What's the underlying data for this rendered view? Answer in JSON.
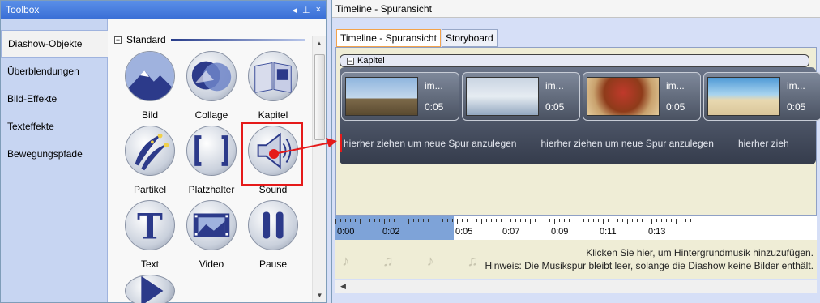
{
  "toolbox": {
    "title": "Toolbox",
    "controls": [
      "◂",
      "⊥",
      "×"
    ],
    "categories": [
      "Diashow-Objekte",
      "Überblendungen",
      "Bild-Effekte",
      "Texteffekte",
      "Bewegungspfade"
    ],
    "group_label": "Standard",
    "items": [
      {
        "label": "Bild"
      },
      {
        "label": "Collage"
      },
      {
        "label": "Kapitel"
      },
      {
        "label": "Partikel"
      },
      {
        "label": "Platzhalter"
      },
      {
        "label": "Sound"
      },
      {
        "label": "Text"
      },
      {
        "label": "Video"
      },
      {
        "label": "Pause"
      }
    ]
  },
  "timeline": {
    "title": "Timeline - Spuransicht",
    "tabs": [
      "Timeline - Spuransicht",
      "Storyboard"
    ],
    "chapter_label": "Kapitel",
    "slides": [
      {
        "name": "im...",
        "duration": "0:05"
      },
      {
        "name": "im...",
        "duration": "0:05"
      },
      {
        "name": "im...",
        "duration": "0:05"
      },
      {
        "name": "im...",
        "duration": "0:05"
      }
    ],
    "drop_hint": "hierher ziehen um neue Spur anzulegen",
    "drop_hint_cut": "hierher zieh",
    "ruler_labels": [
      "0:00",
      "0:02",
      "0:05",
      "0:07",
      "0:09",
      "0:11",
      "0:13"
    ],
    "music_line1": "Klicken Sie hier, um Hintergrundmusik hinzuzufügen.",
    "music_line2": "Hinweis: Die Musikspur bleibt leer, solange die Diashow keine Bilder enthält."
  },
  "colors": {
    "highlight": "#e51a1a",
    "title_bar": "#3a6fd6",
    "selection": "#7ea3d8"
  }
}
